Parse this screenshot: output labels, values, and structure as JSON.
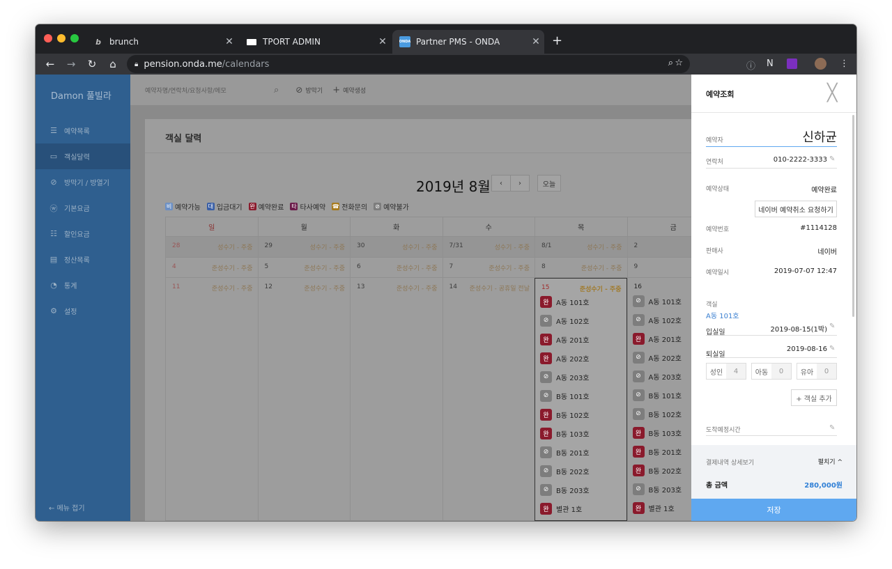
{
  "browser": {
    "tabs": [
      {
        "title": "brunch",
        "favicon": "brunch-b-icon"
      },
      {
        "title": "TPORT ADMIN",
        "favicon": "tport-logo-icon"
      },
      {
        "title": "Partner PMS - ONDA",
        "favicon": "onda-logo-icon",
        "favicon_text": "ONDA"
      }
    ],
    "address": {
      "host": "pension.onda.me",
      "path": "/calendars"
    }
  },
  "sidebar": {
    "brand": "Damon 풀빌라",
    "items": [
      {
        "label": "예약목록",
        "icon": "list-icon"
      },
      {
        "label": "객실달력",
        "icon": "calendar-icon"
      },
      {
        "label": "방막기 / 방열기",
        "icon": "block-icon"
      },
      {
        "label": "기본요금",
        "icon": "won-icon"
      },
      {
        "label": "할인요금",
        "icon": "sliders-icon"
      },
      {
        "label": "정산목록",
        "icon": "receipt-icon"
      },
      {
        "label": "통계",
        "icon": "pie-chart-icon"
      },
      {
        "label": "설정",
        "icon": "gear-icon"
      }
    ],
    "collapse_label": "메뉴 접기"
  },
  "topbar": {
    "search_placeholder": "예약자명/연락처/요청사항/메모",
    "block_label": "방막기",
    "create_label": "예약생성"
  },
  "calendar": {
    "card_title": "객실 달력",
    "month_title": "2019년 8월",
    "today_label": "오늘",
    "legend": [
      {
        "glyph": "비",
        "label": "예약가능",
        "color": "#6b8fc4"
      },
      {
        "glyph": "대",
        "label": "입금대기",
        "color": "#3a5fa6"
      },
      {
        "glyph": "완",
        "label": "예약완료",
        "color": "#8a1a2c"
      },
      {
        "glyph": "타",
        "label": "타사예약",
        "color": "#6b1c4a"
      },
      {
        "glyph": "☎",
        "label": "전화문의",
        "color": "#a77a1d"
      },
      {
        "glyph": "⊘",
        "label": "예약불가",
        "color": "#7d7d7d"
      }
    ],
    "weekdays": [
      "일",
      "월",
      "화",
      "수",
      "목",
      "금"
    ],
    "weeks": [
      [
        {
          "d": "28",
          "s": "성수기 - 주중"
        },
        {
          "d": "29",
          "s": "성수기 - 주중"
        },
        {
          "d": "30",
          "s": "성수기 - 주중"
        },
        {
          "d": "7/31",
          "s": "성수기 - 주중"
        },
        {
          "d": "8/1",
          "s": "성수기 - 주중"
        },
        {
          "d": "2",
          "s": "성수기"
        }
      ],
      [
        {
          "d": "4",
          "s": "준성수기 - 주중"
        },
        {
          "d": "5",
          "s": "준성수기 - 주중"
        },
        {
          "d": "6",
          "s": "준성수기 - 주중"
        },
        {
          "d": "7",
          "s": "준성수기 - 주중"
        },
        {
          "d": "8",
          "s": "준성수기 - 주중"
        },
        {
          "d": "9",
          "s": "준성수기"
        }
      ],
      [
        {
          "d": "11",
          "s": "준성수기 - 주중"
        },
        {
          "d": "12",
          "s": "준성수기 - 주중"
        },
        {
          "d": "13",
          "s": "준성수기 - 주중"
        },
        {
          "d": "14",
          "s": "준성수기 - 공휴일 전날"
        },
        {
          "d": "15",
          "s": "준성수기 - 주중"
        },
        {
          "d": "16",
          "s": "준성수기"
        }
      ]
    ],
    "thu_rooms": [
      {
        "room": "A동 101호",
        "status": "done"
      },
      {
        "room": "A동 102호",
        "status": "na"
      },
      {
        "room": "A동 201호",
        "status": "done"
      },
      {
        "room": "A동 202호",
        "status": "done"
      },
      {
        "room": "A동 203호",
        "status": "na"
      },
      {
        "room": "B동 101호",
        "status": "na"
      },
      {
        "room": "B동 102호",
        "status": "done"
      },
      {
        "room": "B동 103호",
        "status": "done"
      },
      {
        "room": "B동 201호",
        "status": "na"
      },
      {
        "room": "B동 202호",
        "status": "na"
      },
      {
        "room": "B동 203호",
        "status": "na"
      },
      {
        "room": "별관 1호",
        "status": "done"
      }
    ],
    "fri_rooms": [
      {
        "room": "A동 101호",
        "status": "na"
      },
      {
        "room": "A동 102호",
        "status": "na"
      },
      {
        "room": "A동 201호",
        "status": "done"
      },
      {
        "room": "A동 202호",
        "status": "na"
      },
      {
        "room": "A동 203호",
        "status": "na"
      },
      {
        "room": "B동 101호",
        "status": "na"
      },
      {
        "room": "B동 102호",
        "status": "na"
      },
      {
        "room": "B동 103호",
        "status": "done"
      },
      {
        "room": "B동 201호",
        "status": "done"
      },
      {
        "room": "B동 202호",
        "status": "done"
      },
      {
        "room": "B동 203호",
        "status": "na"
      },
      {
        "room": "별관 1호",
        "status": "done"
      }
    ],
    "badge_done": "완",
    "badge_na": "⊘"
  },
  "panel": {
    "title": "예약조회",
    "guest_label": "예약자",
    "guest_name": "신하균",
    "phone_label": "연락처",
    "phone": "010-2222-3333",
    "status_label": "예약상태",
    "status": "예약완료",
    "cancel_btn": "네이버 예약취소 요청하기",
    "number_label": "예약번호",
    "number": "#1114128",
    "seller_label": "판매사",
    "seller": "네이버",
    "date_label": "예약일시",
    "date": "2019-07-07 12:47",
    "room_label": "객실",
    "room": "A동 101호",
    "checkin_label": "입실일",
    "checkin": "2019-08-15(1박)",
    "checkout_label": "퇴실일",
    "checkout": "2019-08-16",
    "adult_label": "성인",
    "adult": "4",
    "child_label": "아동",
    "child": "0",
    "infant_label": "유아",
    "infant": "0",
    "add_room": "+ 객실 추가",
    "arrival_label": "도착예정시간",
    "payment_label": "결제내역 상세보기",
    "expand_label": "펼치기 ^",
    "total_label": "총 금액",
    "total": "280,000원",
    "save": "저장"
  }
}
